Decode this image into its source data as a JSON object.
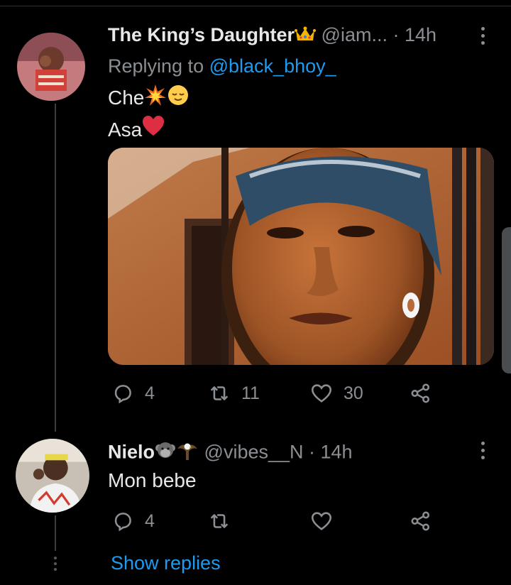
{
  "tweets": [
    {
      "name": "The King’s Daughter",
      "name_emoji": "crown",
      "handle": "@iam...",
      "time": "· 14h",
      "reply_prefix": "Replying to",
      "reply_to": "@black_bhoy_",
      "line1": "Che",
      "line2": "Asa",
      "stats": {
        "replies": "4",
        "retweets": "11",
        "likes": "30"
      }
    },
    {
      "name": "Nielo",
      "handle": "@vibes__N",
      "time": "· 14h",
      "text": "Mon bebe",
      "stats": {
        "replies": "4",
        "retweets": "",
        "likes": ""
      }
    }
  ],
  "show_replies": "Show replies",
  "colors": {
    "accent": "#1d9bf0",
    "background": "#000000",
    "muted": "#8b8f93"
  },
  "icons": [
    "crown-icon",
    "collision-icon",
    "relieved-face-icon",
    "red-heart-icon",
    "monkey-icon",
    "eagle-icon",
    "reply-icon",
    "retweet-icon",
    "like-icon",
    "share-icon",
    "more-icon"
  ]
}
